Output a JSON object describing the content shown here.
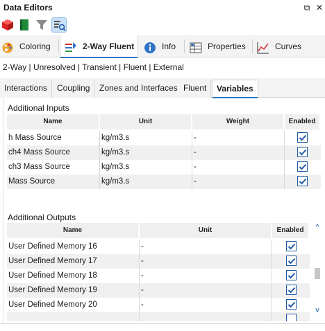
{
  "window": {
    "title": "Data Editors",
    "restore_glyph": "⧉",
    "close_glyph": "✕"
  },
  "toolbar": {
    "buttons": [
      {
        "name": "cube-red-icon",
        "active": false
      },
      {
        "name": "book-green-icon",
        "active": false
      },
      {
        "name": "filter-icon",
        "active": false
      },
      {
        "name": "search-list-icon",
        "active": true
      }
    ]
  },
  "main_tabs": [
    {
      "label": "Coloring",
      "icon": "palette-icon",
      "active": false
    },
    {
      "label": "2-Way Fluent",
      "icon": "coupling-icon",
      "active": true
    },
    {
      "label": "Info",
      "icon": "info-icon",
      "active": false
    },
    {
      "label": "Properties",
      "icon": "properties-grid-icon",
      "active": false
    },
    {
      "label": "Curves",
      "icon": "curves-chart-icon",
      "active": false
    }
  ],
  "status_line": "2-Way | Unresolved | Transient | Fluent | External",
  "sub_tabs": [
    {
      "label": "Interactions",
      "active": false
    },
    {
      "label": "Coupling",
      "active": false
    },
    {
      "label": "Zones and Interfaces",
      "active": false
    },
    {
      "label": "Fluent",
      "active": false
    },
    {
      "label": "Variables",
      "active": true
    }
  ],
  "additional_inputs": {
    "title": "Additional Inputs",
    "columns": [
      "Name",
      "Unit",
      "Weight",
      "Enabled"
    ],
    "rows": [
      {
        "name": "h Mass Source",
        "unit": "kg/m3.s",
        "weight": "-",
        "enabled": true
      },
      {
        "name": "ch4 Mass Source",
        "unit": "kg/m3.s",
        "weight": "-",
        "enabled": true
      },
      {
        "name": "ch3 Mass Source",
        "unit": "kg/m3.s",
        "weight": "-",
        "enabled": true
      },
      {
        "name": "Mass Source",
        "unit": "kg/m3.s",
        "weight": "-",
        "enabled": true
      }
    ]
  },
  "additional_outputs": {
    "title": "Additional Outputs",
    "columns": [
      "Name",
      "Unit",
      "Enabled"
    ],
    "rows": [
      {
        "name": "User Defined Memory 16",
        "unit": "-",
        "enabled": true
      },
      {
        "name": "User Defined Memory 17",
        "unit": "-",
        "enabled": true
      },
      {
        "name": "User Defined Memory 18",
        "unit": "-",
        "enabled": true
      },
      {
        "name": "User Defined Memory 19",
        "unit": "-",
        "enabled": true
      },
      {
        "name": "User Defined Memory 20",
        "unit": "-",
        "enabled": true
      }
    ],
    "scroll_up_glyph": "^",
    "scroll_down_glyph": "v"
  },
  "colors": {
    "accent": "#2f74c7",
    "checkbox_border": "#1f5aa6",
    "header_bg": "#efefef",
    "alt_row_bg": "#f0f0f0"
  }
}
